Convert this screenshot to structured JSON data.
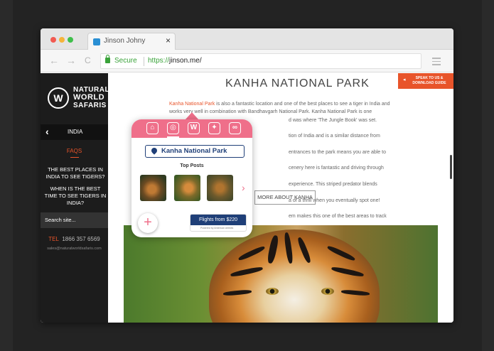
{
  "browser": {
    "tab_title": "Jinson Johny",
    "tab_close": "×",
    "back": "←",
    "forward": "→",
    "reload": "C",
    "secure_label": "Secure",
    "url_protocol": "https://",
    "url_rest": "jinson.me/"
  },
  "sidebar": {
    "logo_mark": "W",
    "logo_line1": "NATURAL",
    "logo_line2": "WORLD",
    "logo_line3": "SAFARIS",
    "region": "INDIA",
    "faqs": "FAQS",
    "links": [
      "THE BEST PLACES IN INDIA TO SEE TIGERS?",
      "WHEN IS THE BEST TIME TO SEE TIGERS IN INDIA?"
    ],
    "search_placeholder": "Search site...",
    "phone_prefix": "TEL",
    "phone": "1866 357 6569",
    "email": "sales@naturalworldsafaris.com"
  },
  "main": {
    "speak_button": "SPEAK TO US & DOWNLOAD GUIDE",
    "title": "KANHA NATIONAL PARK",
    "intro_highlight": "Kanha National Park",
    "intro_text_1": " is also a fantastic location and one of the best places to see a tiger in India and works very well in combination with Bandhavgarh National Park. Kanha National Park is one",
    "intro_text_2": "d was where 'The Jungle Book' was set. Kanha is also",
    "intro_text_3": "tion of India and is a similar distance from Jabalpur Airport.",
    "intro_text_4": "entrances to the park means you are able to drive from",
    "intro_text_5": "cenery here is fantastic and driving through this park",
    "intro_text_6": "experience. This striped predator blends effortlessly into the",
    "intro_text_7": "a of a thrill when you eventually spot one! Kanha's rich",
    "intro_text_8": "em makes this one of the best areas to track tigers in the",
    "more_button": "MORE ABOUT KANHA"
  },
  "popup": {
    "location": "Kanha National Park",
    "top_posts_label": "Top Posts",
    "flights_label": "Flights from $220",
    "flights_sub": "Powered by American Airlines",
    "plus": "+",
    "next": "›"
  },
  "colors": {
    "accent_orange": "#e8542a",
    "popup_pink": "#ef6f8a",
    "popup_navy": "#1f3f78"
  }
}
